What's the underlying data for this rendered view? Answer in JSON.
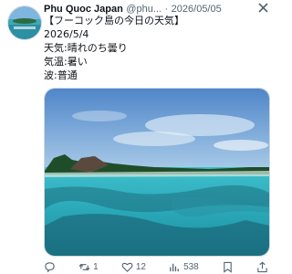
{
  "tweet": {
    "author_name": "Phu Quoc Japan",
    "handle": "@phu...",
    "dot": "·",
    "date": "2026/05/05",
    "text_lines": [
      "【フーコック島の今日の天気】",
      "2026/5/4",
      "天気:晴れのち曇り",
      "気温:暑い",
      "波:普通"
    ]
  },
  "actions": {
    "retweet_count": "1",
    "like_count": "12",
    "view_count": "538"
  },
  "icons": [
    "close-icon",
    "comment-icon",
    "retweet-icon",
    "heart-icon",
    "views-icon",
    "bookmark-icon",
    "share-icon"
  ],
  "colors": {
    "muted": "#536471",
    "text": "#0f1419"
  }
}
